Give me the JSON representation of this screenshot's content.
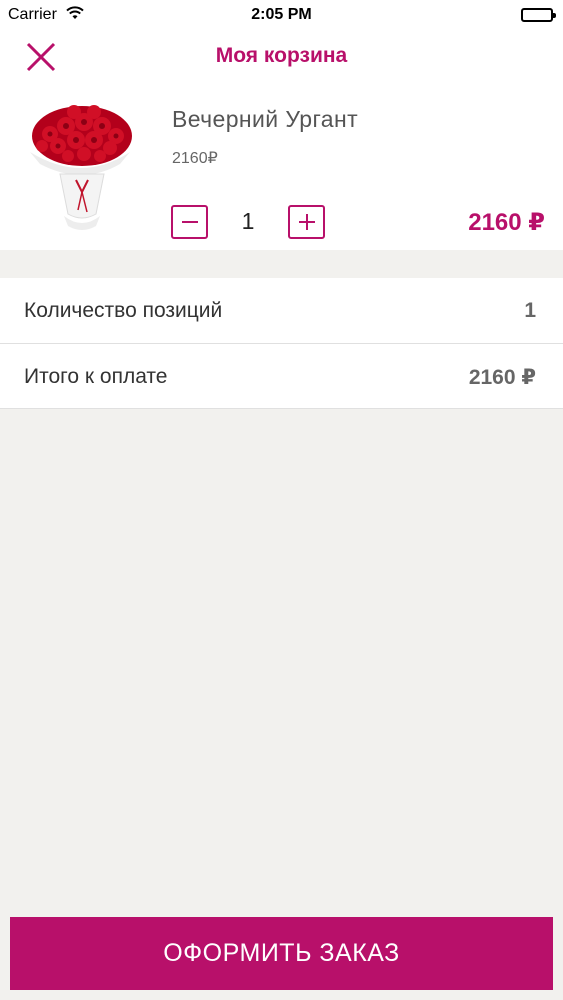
{
  "status_bar": {
    "carrier": "Carrier",
    "time": "2:05 PM",
    "wifi_icon": "wifi-icon",
    "battery_level": 1.0
  },
  "header": {
    "title": "Моя корзина",
    "close_icon": "close-icon"
  },
  "cart": {
    "items": [
      {
        "name": "Вечерний Ургант",
        "unit_price": "2160₽",
        "quantity": "1",
        "total": "2160 ₽",
        "image": "red-roses-bouquet"
      }
    ]
  },
  "summary": {
    "rows": [
      {
        "label": "Количество позиций",
        "value": "1"
      },
      {
        "label": "Итого к оплате",
        "value": "2160 ₽"
      }
    ]
  },
  "checkout": {
    "label": "ОФОРМИТЬ ЗАКАЗ"
  },
  "colors": {
    "accent": "#b8106a",
    "background": "#f2f1ee",
    "surface": "#ffffff"
  }
}
